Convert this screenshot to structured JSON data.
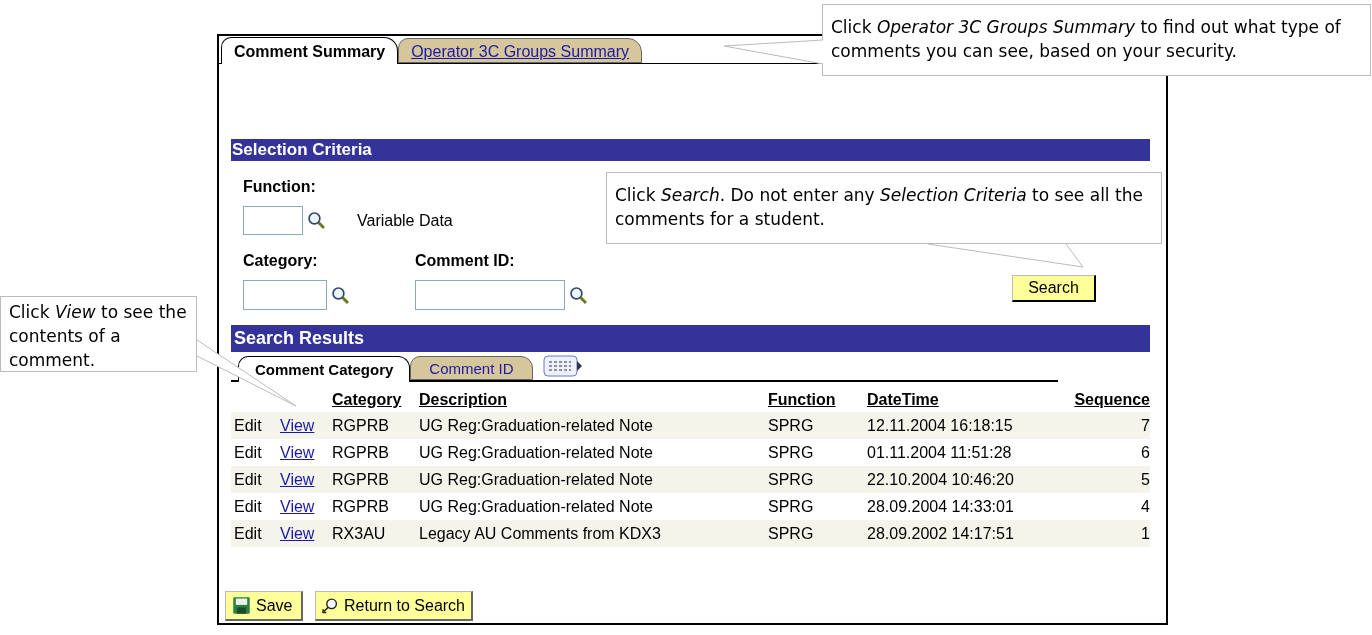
{
  "tabs": [
    {
      "label": "Comment Summary",
      "selected": true
    },
    {
      "label": "Operator 3C Groups Summary",
      "selected": false
    }
  ],
  "selection_criteria": {
    "title": "Selection Criteria",
    "function": {
      "label": "Function:",
      "description": "Variable Data"
    },
    "category": {
      "label": "Category:"
    },
    "comment_id": {
      "label": "Comment ID:"
    },
    "search_button": "Search"
  },
  "search_results": {
    "title": "Search Results",
    "tabs": [
      {
        "label": "Comment Category",
        "selected": true
      },
      {
        "label": "Comment ID",
        "selected": false
      }
    ],
    "columns": [
      "Category",
      "Description",
      "Function",
      "DateTime",
      "Sequence"
    ],
    "rows": [
      {
        "edit": "Edit",
        "view": "View",
        "category": "RGPRB",
        "description": "UG Reg:Graduation-related Note",
        "function": "SPRG",
        "datetime": "12.11.2004 16:18:15",
        "sequence": "7"
      },
      {
        "edit": "Edit",
        "view": "View",
        "category": "RGPRB",
        "description": "UG Reg:Graduation-related Note",
        "function": "SPRG",
        "datetime": "01.11.2004 11:51:28",
        "sequence": "6"
      },
      {
        "edit": "Edit",
        "view": "View",
        "category": "RGPRB",
        "description": "UG Reg:Graduation-related Note",
        "function": "SPRG",
        "datetime": "22.10.2004 10:46:20",
        "sequence": "5"
      },
      {
        "edit": "Edit",
        "view": "View",
        "category": "RGPRB",
        "description": "UG Reg:Graduation-related Note",
        "function": "SPRG",
        "datetime": "28.09.2004 14:33:01",
        "sequence": "4"
      },
      {
        "edit": "Edit",
        "view": "View",
        "category": "RX3AU",
        "description": "Legacy AU Comments from KDX3",
        "function": "SPRG",
        "datetime": "28.09.2002 14:17:51",
        "sequence": "1"
      }
    ]
  },
  "buttons": [
    "Save",
    "Return to Search"
  ],
  "callouts": [
    {
      "text": "Click *Operator 3C Groups Summary* to find out what type of comments you can see, based on your security."
    },
    {
      "text": "Click *Search*. Do not enter any *Selection Criteria* to see all the comments for a student."
    },
    {
      "text": "Click *View* to see the contents of a comment."
    }
  ]
}
